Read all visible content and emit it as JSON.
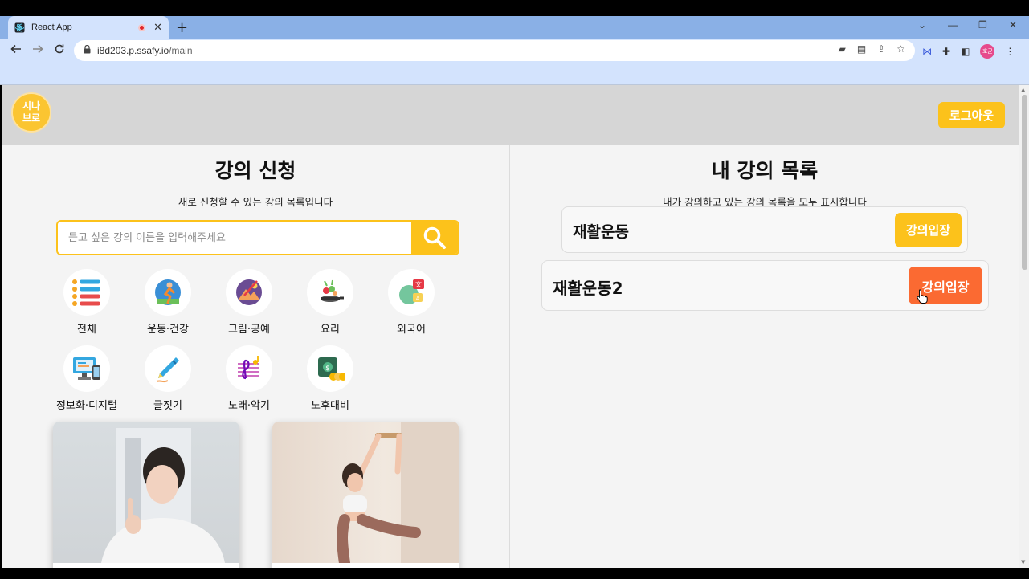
{
  "browser": {
    "tab_title": "React App",
    "tab_close": "✕",
    "new_tab": "+",
    "url_host": "i8d203.p.ssafy.io",
    "url_path": "/main",
    "profile_label": "호균",
    "win_controls": {
      "minimize": "—",
      "restore": "❐",
      "close": "✕",
      "dropdown": "⌄"
    }
  },
  "header": {
    "logo_text": "시나\n브로",
    "logout_label": "로그아웃"
  },
  "apply": {
    "title": "강의 신청",
    "subtitle": "새로 신청할 수 있는 강의 목록입니다",
    "search_placeholder": "듣고 싶은 강의 이름을 입력해주세요",
    "categories": [
      {
        "label": "전체",
        "icon": "list-icon"
      },
      {
        "label": "운동·건강",
        "icon": "exercise-icon"
      },
      {
        "label": "그림·공예",
        "icon": "art-icon"
      },
      {
        "label": "요리",
        "icon": "cooking-icon"
      },
      {
        "label": "외국어",
        "icon": "language-icon"
      },
      {
        "label": "정보화·디지털",
        "icon": "computer-icon"
      },
      {
        "label": "글짓기",
        "icon": "pen-icon"
      },
      {
        "label": "노래·악기",
        "icon": "music-icon"
      },
      {
        "label": "노후대비",
        "icon": "money-icon"
      }
    ]
  },
  "my_lectures": {
    "title": "내 강의 목록",
    "subtitle": "내가 강의하고 있는 강의 목록을 모두 표시합니다",
    "items": [
      {
        "name": "재활운동",
        "button": "강의입장",
        "button_color": "#fcc21b"
      },
      {
        "name": "재활운동2",
        "button": "강의입장",
        "button_color": "#fb6a32"
      }
    ]
  },
  "colors": {
    "accent": "#fcc21b",
    "hover": "#fb6a32",
    "header_bg": "#d6d6d6"
  }
}
